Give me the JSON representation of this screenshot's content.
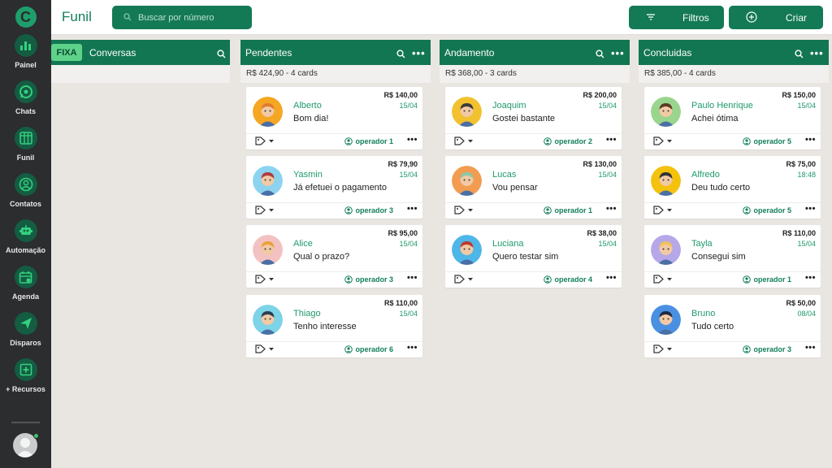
{
  "app": {
    "title": "Funil",
    "logo": "C"
  },
  "sidebar": {
    "items": [
      {
        "label": "Painel",
        "icon": "bar-chart-icon"
      },
      {
        "label": "Chats",
        "icon": "whatsapp-icon"
      },
      {
        "label": "Funil",
        "icon": "kanban-icon"
      },
      {
        "label": "Contatos",
        "icon": "contacts-icon"
      },
      {
        "label": "Automação",
        "icon": "robot-icon"
      },
      {
        "label": "Agenda",
        "icon": "calendar-icon"
      },
      {
        "label": "Disparos",
        "icon": "send-icon"
      },
      {
        "label": "+ Recursos",
        "icon": "plus-box-icon"
      }
    ]
  },
  "header": {
    "search_placeholder": "Buscar por número",
    "filters_label": "Filtros",
    "create_label": "Criar"
  },
  "colors": {
    "primary": "#137653",
    "accent_green": "#1f9a6b",
    "sidebar": "#2b2d2f",
    "badge": "#5ed28a"
  },
  "columns": [
    {
      "title": "Conversas",
      "badge": "FIXA",
      "summary": "",
      "cards": []
    },
    {
      "title": "Pendentes",
      "summary": "R$ 424,90 - 4 cards",
      "cards": [
        {
          "name": "Alberto",
          "msg": "Bom dia!",
          "value": "R$ 140,00",
          "date": "15/04",
          "operator": "operador 1"
        },
        {
          "name": "Yasmin",
          "msg": "Já efetuei o pagamento",
          "value": "R$ 79,90",
          "date": "15/04",
          "operator": "operador 3"
        },
        {
          "name": "Alice",
          "msg": "Qual o prazo?",
          "value": "R$ 95,00",
          "date": "15/04",
          "operator": "operador 3"
        },
        {
          "name": "Thiago",
          "msg": "Tenho interesse",
          "value": "R$ 110,00",
          "date": "15/04",
          "operator": "operador 6"
        }
      ]
    },
    {
      "title": "Andamento",
      "summary": "R$ 368,00 - 3 cards",
      "cards": [
        {
          "name": "Joaquim",
          "msg": "Gostei bastante",
          "value": "R$ 200,00",
          "date": "15/04",
          "operator": "operador 2"
        },
        {
          "name": "Lucas",
          "msg": "Vou pensar",
          "value": "R$ 130,00",
          "date": "15/04",
          "operator": "operador 1"
        },
        {
          "name": "Luciana",
          "msg": "Quero testar sim",
          "value": "R$ 38,00",
          "date": "15/04",
          "operator": "operador 4"
        }
      ]
    },
    {
      "title": "Concluidas",
      "summary": "R$ 385,00 - 4 cards",
      "cards": [
        {
          "name": "Paulo Henrique",
          "msg": "Achei ótima",
          "value": "R$ 150,00",
          "date": "15/04",
          "operator": "operador 5"
        },
        {
          "name": "Alfredo",
          "msg": "Deu tudo certo",
          "value": "R$ 75,00",
          "date": "18:48",
          "operator": "operador 5"
        },
        {
          "name": "Tayla",
          "msg": "Consegui sim",
          "value": "R$ 110,00",
          "date": "15/04",
          "operator": "operador 1"
        },
        {
          "name": "Bruno",
          "msg": "Tudo certo",
          "value": "R$ 50,00",
          "date": "08/04",
          "operator": "operador 3"
        }
      ]
    }
  ]
}
